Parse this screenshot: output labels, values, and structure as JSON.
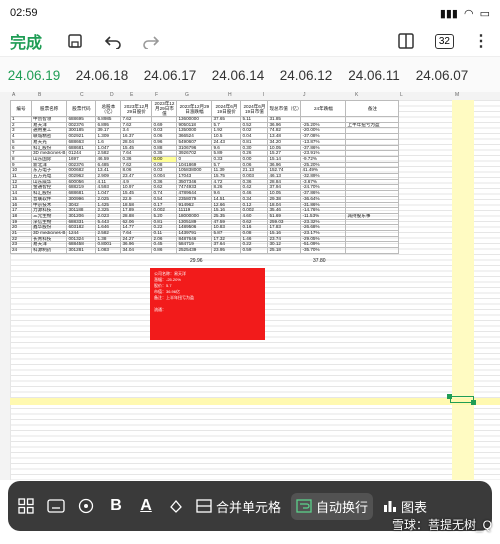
{
  "status_bar": {
    "time": "02:59",
    "battery": "100"
  },
  "toolbar": {
    "done_label": "完成",
    "sheet_count": "32"
  },
  "tabs": [
    "24.06.19",
    "24.06.18",
    "24.06.17",
    "24.06.14",
    "24.06.12",
    "24.06.11",
    "24.06.07"
  ],
  "active_tab_index": 0,
  "columns": [
    "A",
    "B",
    "C",
    "D",
    "E",
    "F",
    "G",
    "H",
    "I",
    "J",
    "K",
    "L",
    "M"
  ],
  "table": {
    "headers": [
      "编号",
      "股票名称",
      "股票代码",
      "总股本（亿）",
      "2023年12月29日股价",
      "2023年12月29日市值",
      "2023年12月29日涨跌幅",
      "2024年6月19日股价",
      "2024年6月19日市值",
      "现总市值（亿）",
      "24年跌幅",
      "备注"
    ],
    "rows": [
      [
        "1",
        "中创智领",
        "688695",
        "6.8985",
        "7.62",
        "",
        "13600000",
        "37.65",
        "5.11",
        "31.85",
        "",
        ""
      ],
      [
        "2",
        "易天洋",
        "002376",
        "6.895",
        "7.62",
        "0.69",
        "9050118",
        "5.7",
        "0.52",
        "36.96",
        "-25.20%",
        "上半年扭亏为盈"
      ],
      [
        "3",
        "通用重工",
        "300185",
        "39.17",
        "3.4",
        "0.03",
        "1350000",
        "1.92",
        "0.02",
        "74.82",
        "-20.00%",
        ""
      ],
      [
        "4",
        "联城精密",
        "002921",
        "1.309",
        "16.37",
        "0.06",
        "366524",
        "10.5",
        "0.04",
        "13.48",
        "-37.08%",
        ""
      ],
      [
        "5",
        "易天光",
        "688663",
        "1.6",
        "28.04",
        "0.96",
        "5490607",
        "24.43",
        "0.81",
        "34.20",
        "-13.87%",
        ""
      ],
      [
        "6",
        "科汇股份",
        "688681",
        "1.047",
        "15.45",
        "0.88",
        "3106796",
        "9.6",
        "0.30",
        "10.05",
        "-37.86%",
        ""
      ],
      [
        "7",
        "3D medicines-B",
        "01244",
        "2.582",
        "7.64",
        "0.35",
        "3926702",
        "5.89",
        "0.26",
        "15.27",
        "-23.91%",
        ""
      ],
      [
        "8",
        "山东国际",
        "1697",
        "46.59",
        "0.36",
        "0.00",
        "0",
        "0.33",
        "0.00",
        "15.14",
        "-9.72%",
        ""
      ],
      [
        "9",
        "新北洋",
        "002376",
        "6.485",
        "7.62",
        "0.08",
        "1041869",
        "5.7",
        "0.06",
        "36.96",
        "-25.20%",
        ""
      ],
      [
        "10",
        "东方电子",
        "000682",
        "13.41",
        "8.06",
        "0.03",
        "105838000",
        "11.39",
        "21.13",
        "152.74",
        "41.49%",
        ""
      ],
      [
        "11",
        "五方光电",
        "002962",
        "2.909",
        "23.47",
        "0.004",
        "17043",
        "15.75",
        "0.003",
        "46.13",
        "-32.89%",
        ""
      ],
      [
        "12",
        "山东威华",
        "600056",
        "4.11",
        "4.9",
        "0.36",
        "3507346",
        "4.72",
        "0.36",
        "28.84",
        "-3.67%",
        ""
      ],
      [
        "13",
        "金通智控",
        "688219",
        "4.593",
        "10.97",
        "0.62",
        "7474933",
        "8.26",
        "0.42",
        "37.94",
        "-24.70%",
        ""
      ],
      [
        "14",
        "科汇股份",
        "688681",
        "1.047",
        "15.45",
        "0.74",
        "4789644",
        "9.6",
        "0.46",
        "10.05",
        "-37.86%",
        ""
      ],
      [
        "15",
        "普联软件",
        "300996",
        "2.025",
        "22.9",
        "0.54",
        "2358079",
        "14.51",
        "0.34",
        "29.38",
        "-36.64%",
        ""
      ],
      [
        "16",
        "中京技术",
        "3042",
        "1.425",
        "18.58",
        "0.17",
        "914962",
        "12.66",
        "0.12",
        "18.04",
        "-31.86%",
        ""
      ],
      [
        "17",
        "力源科技",
        "301188",
        "2.325",
        "17.89",
        "0.002",
        "11119",
        "15.16",
        "0.002",
        "35.46",
        "-14.76%",
        ""
      ],
      [
        "18",
        "三元生物",
        "301206",
        "2.023",
        "28.88",
        "5.20",
        "18000000",
        "25.35",
        "4.60",
        "51.69",
        "-11.53%",
        "减持股东事"
      ],
      [
        "19",
        "深信生物",
        "688331",
        "5.443",
        "62.06",
        "0.81",
        "1305189",
        "47.59",
        "0.62",
        "259.03",
        "-23.32%",
        ""
      ],
      [
        "20",
        "鑫华股份",
        "603182",
        "1.646",
        "14.77",
        "0.22",
        "1489506",
        "10.83",
        "0.16",
        "17.83",
        "-26.68%",
        ""
      ],
      [
        "21",
        "3D medicines-B",
        "1244",
        "2.582",
        "7.64",
        "0.11",
        "1439791",
        "5.87",
        "0.08",
        "15.16",
        "-23.17%",
        ""
      ],
      [
        "22",
        "长青科技",
        "001324",
        "1.38",
        "24.27",
        "2.06",
        "8487646",
        "17.32",
        "1.46",
        "23.74",
        "-29.05%",
        ""
      ],
      [
        "23",
        "易天洋",
        "688458",
        "0.8001",
        "36.96",
        "0.45",
        "584719",
        "37.64",
        "0.22",
        "30.12",
        "-51.09%",
        ""
      ],
      [
        "24",
        "科源制药",
        "301281",
        "1.083",
        "34.04",
        "0.86",
        "2525439",
        "23.95",
        "0.59",
        "25.18",
        "-35.70%",
        ""
      ]
    ],
    "totals": {
      "f": "29.96",
      "i": "37.80"
    }
  },
  "red_block": {
    "lines": [
      "公司名称：易天洋",
      "涨幅：-25.20%",
      "股价：5.7",
      "市值：36.96亿",
      "备注：上半年扭亏为盈",
      "",
      "流通：",
      "",
      "",
      "",
      ""
    ]
  },
  "bottom_toolbar": {
    "merge_label": "合并单元格",
    "wrap_label": "自动换行",
    "chart_label": "图表"
  },
  "watermark": "雪球：菩提无树_Q"
}
